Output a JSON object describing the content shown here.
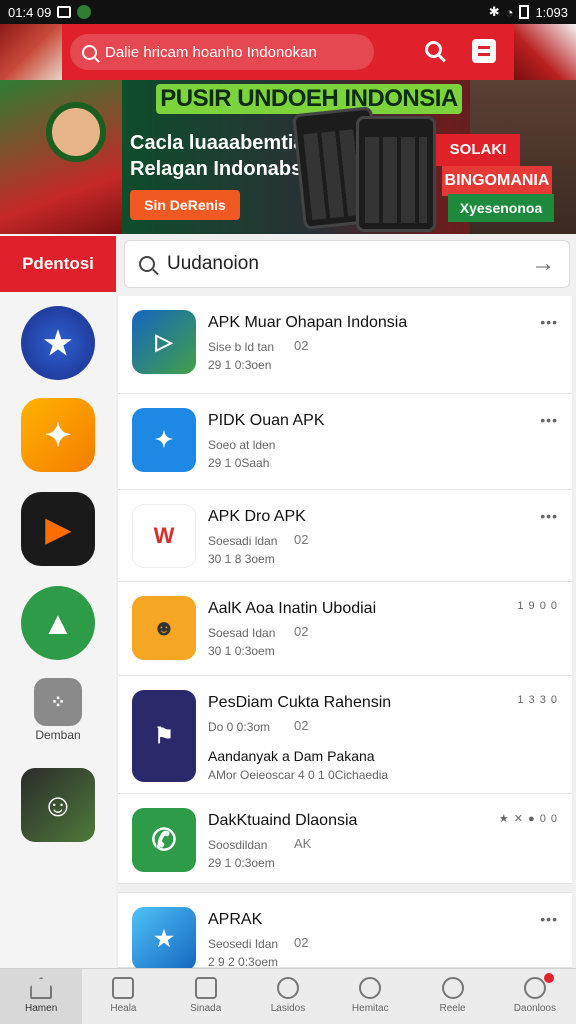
{
  "status_bar": {
    "time": "01:4 09",
    "right_text": "1:093"
  },
  "header": {
    "search_placeholder": "Dalie hricam hoanho Indonokan"
  },
  "banner": {
    "title": "PUSIR UNDOEH INDONSIA",
    "line1": "Cacla luaaabemtiay",
    "line2": "Relagan Indonabsid",
    "button": "Sin DeRenis",
    "tag1": "SOLAKI",
    "tag2": "BINGOMANIA",
    "tag3": "Xyesenonoa"
  },
  "sidebar": {
    "tab_label": "Pdentosi",
    "items": [
      {
        "icon": "star-logo-icon",
        "label": ""
      },
      {
        "icon": "star-orange-icon",
        "label": ""
      },
      {
        "icon": "play-icon",
        "label": ""
      },
      {
        "icon": "triangle-green-icon",
        "label": ""
      },
      {
        "icon": "dots-grid-icon",
        "label": "Demban"
      },
      {
        "icon": "portrait-icon",
        "label": ""
      }
    ]
  },
  "list": {
    "search_text": "Uudanoion",
    "apps": [
      {
        "title": "APK Muar Ohapan Indonsia",
        "meta1": "Sise b ld tan",
        "meta2": "29 1 0:3oen",
        "code": "02",
        "more": "•••"
      },
      {
        "title": "PIDK Ouan APK",
        "meta1": "Soeo at lden",
        "meta2": "29 1 0Saah",
        "code": "",
        "more": "•••"
      },
      {
        "title": "APK Dro APK",
        "meta1": "Soesadi ldan",
        "meta2": "30 1 8 3oem",
        "code": "02",
        "more": "•••"
      },
      {
        "title": "AalK Aoa Inatin Ubodiai",
        "meta1": "Soesad Idan",
        "meta2": "30 1 0:3oem",
        "code": "02",
        "more": "1 9 0 0"
      },
      {
        "title": "PesDiam Cukta Rahensin",
        "meta1": "Do 0 0:3om",
        "meta2": "",
        "code": "02",
        "more": "1 3 3 0",
        "extra1": "Aandanyak a Dam Pakana",
        "extra2": "AMor Oeieoscar 4 0 1 0Cichaedia"
      },
      {
        "title": "DakKtuaind Dlaonsia",
        "meta1": "Soosdildan",
        "meta2": "29 1 0:3oem",
        "code": "AK",
        "more": "★ ✕ ● 0 0"
      },
      {
        "title": "APRAK",
        "meta1": "Seosedi Idan",
        "meta2": "2 9 2 0:3oem",
        "code": "02",
        "more": "•••"
      }
    ]
  },
  "bottom_nav": {
    "items": [
      {
        "label": "Hamen",
        "icon": "home-icon"
      },
      {
        "label": "Heala",
        "icon": "box-icon"
      },
      {
        "label": "Sinada",
        "icon": "edit-icon"
      },
      {
        "label": "Lasidos",
        "icon": "chat-icon"
      },
      {
        "label": "Hemitac",
        "icon": "settings-icon"
      },
      {
        "label": "Reele",
        "icon": "search-icon"
      },
      {
        "label": "Daonloos",
        "icon": "user-icon"
      }
    ]
  },
  "colors": {
    "brand_red": "#e0202a",
    "accent_orange": "#f05a22",
    "green": "#2e7d32"
  }
}
